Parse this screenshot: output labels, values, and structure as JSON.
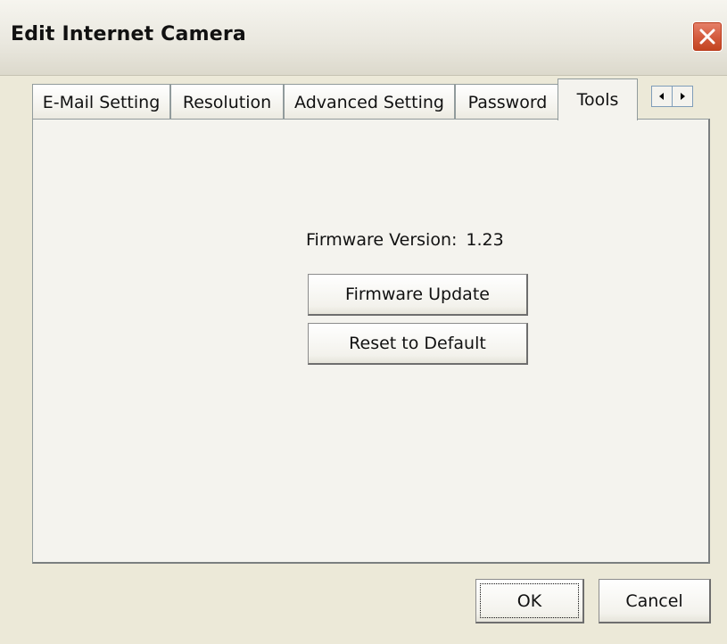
{
  "window": {
    "title": "Edit Internet Camera",
    "close_icon": "close-icon"
  },
  "tabs": [
    {
      "label": "E-Mail Setting",
      "active": false
    },
    {
      "label": "Resolution",
      "active": false
    },
    {
      "label": "Advanced Setting",
      "active": false
    },
    {
      "label": "Password",
      "active": false
    },
    {
      "label": "Tools",
      "active": true
    }
  ],
  "tab_scroll": {
    "left_icon": "arrow-left-icon",
    "right_icon": "arrow-right-icon"
  },
  "tools": {
    "firmware_label": "Firmware Version:",
    "firmware_value": "1.23",
    "firmware_update_label": "Firmware Update",
    "reset_label": "Reset to Default"
  },
  "footer": {
    "ok_label": "OK",
    "cancel_label": "Cancel"
  },
  "colors": {
    "dialog_bg": "#ece9d8",
    "panel_bg": "#f4f3ee",
    "close_red": "#d35a3c"
  }
}
